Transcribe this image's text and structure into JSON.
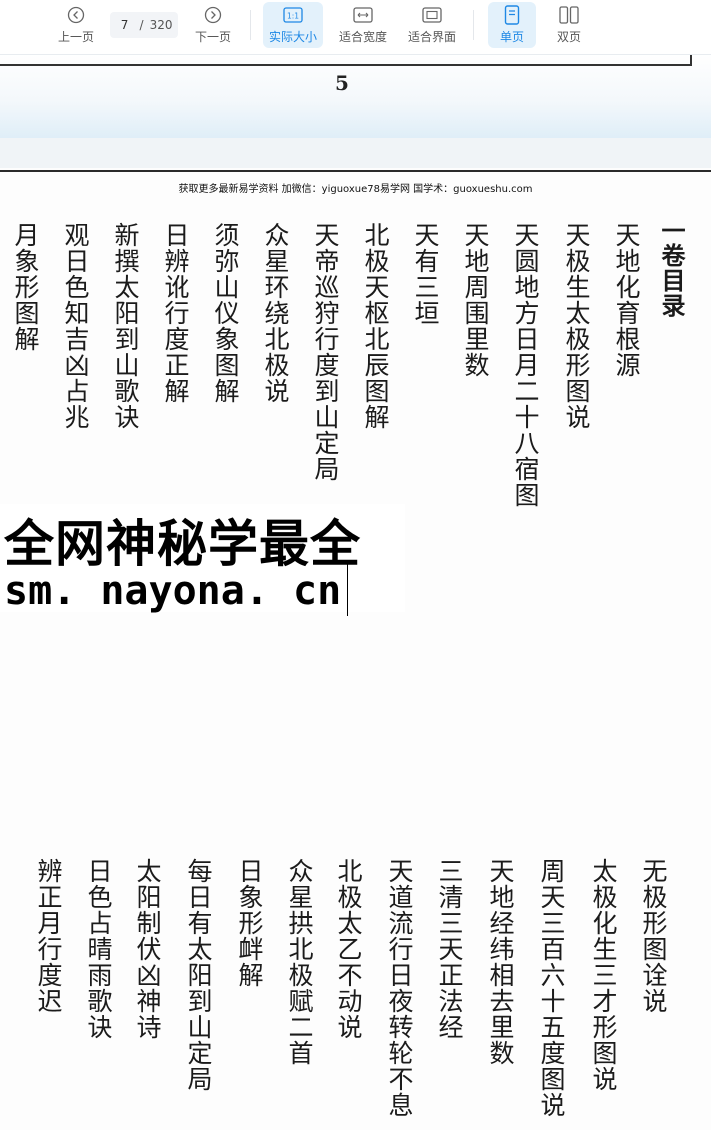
{
  "toolbar": {
    "prev_label": "上一页",
    "next_label": "下一页",
    "current_page": "7",
    "page_separator": "/",
    "total_pages": "320",
    "actual_size_label": "实际大小",
    "actual_size_icon_text": "1:1",
    "fit_width_label": "适合宽度",
    "fit_page_label": "适合界面",
    "single_page_label": "单页",
    "double_page_label": "双页",
    "accent_color": "#1e88e5"
  },
  "prev_page": {
    "page_number": "5"
  },
  "page": {
    "header": "获取更多最新易学资料 加微信：yiguoxue78易学网 国学术：guoxueshu.com",
    "title": "一卷目录",
    "upper_entries": [
      "天地化育根源",
      "天极生太极形图说",
      "天圆地方日月二十八宿图",
      "天地周围里数",
      "天有三垣",
      "北极天枢北辰图解",
      "天帝巡狩行度到山定局",
      "众星环绕北极说",
      "须弥山仪象图解",
      "日辨讹行度正解",
      "新撰太阳到山歌诀",
      "观日色知吉凶占兆",
      "月象形图解"
    ],
    "lower_entries": [
      "无极形图诠说",
      "太极化生三才形图说",
      "周天三百六十五度图说",
      "天地经纬相去里数",
      "三清三天正法经",
      "天道流行日夜转轮不息",
      "北极太乙不动说",
      "众星拱北极赋二首",
      "日象形衅解",
      "每日有太阳到山定局",
      "太阳制伏凶神诗",
      "日色占晴雨歌诀",
      "辨正月行度迟"
    ]
  },
  "watermark": {
    "line1": "全网神秘学最全",
    "line2": "sm. nayona. cn"
  }
}
